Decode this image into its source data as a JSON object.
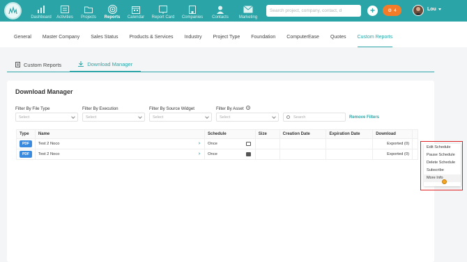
{
  "topnav": {
    "items": [
      {
        "label": "Dashboard",
        "icon": "bar-chart-icon"
      },
      {
        "label": "Activities",
        "icon": "calendar-list-icon"
      },
      {
        "label": "Projects",
        "icon": "folder-icon"
      },
      {
        "label": "Reports",
        "icon": "target-icon",
        "active": true
      },
      {
        "label": "Calendar",
        "icon": "calendar-icon"
      },
      {
        "label": "Report Card",
        "icon": "report-card-icon"
      },
      {
        "label": "Companies",
        "icon": "building-icon"
      },
      {
        "label": "Contacts",
        "icon": "person-icon"
      },
      {
        "label": "Marketing",
        "icon": "envelope-icon"
      }
    ],
    "search_placeholder": "Search project, company, contact, d",
    "notification_count": "4",
    "user_name": "Lou"
  },
  "subnav": {
    "items": [
      "General",
      "Master Company",
      "Sales Status",
      "Products & Services",
      "Industry",
      "Project Type",
      "Foundation",
      "ComputerEase",
      "Quotes",
      "Custom Reports"
    ],
    "active": "Custom Reports"
  },
  "tabs": {
    "custom_reports": "Custom Reports",
    "download_manager": "Download Manager"
  },
  "panel": {
    "title": "Download Manager",
    "filters": {
      "file_type_label": "Filter By File Type",
      "execution_label": "Filter By Execution",
      "source_widget_label": "Filter By Source Widget",
      "asset_label": "Filter By Asset",
      "select_placeholder": "Select",
      "search_placeholder": "Search",
      "remove_filters": "Remove Filters"
    },
    "table": {
      "headers": {
        "type": "Type",
        "name": "Name",
        "schedule": "Schedule",
        "size": "Size",
        "creation_date": "Creation Date",
        "expiration_date": "Expiration Date",
        "download": "Download"
      },
      "rows": [
        {
          "type": "PDF",
          "name": "Test 2 Noco",
          "schedule": "Once",
          "size": "",
          "creation_date": "",
          "expiration_date": "",
          "download": "Exported (0)"
        },
        {
          "type": "PDF",
          "name": "Test 2 Noco",
          "schedule": "Once",
          "size": "",
          "creation_date": "",
          "expiration_date": "",
          "download": "Exported (0)"
        }
      ]
    }
  },
  "context_menu": {
    "items": [
      "Edit Schedule",
      "Pause Schedule",
      "Delete Schedule",
      "Subscribe",
      "More Info"
    ]
  },
  "colors": {
    "brand": "#2aa4a6",
    "notification": "#f47c29",
    "pdf_badge": "#3a8be0",
    "highlight": "#e02020"
  }
}
